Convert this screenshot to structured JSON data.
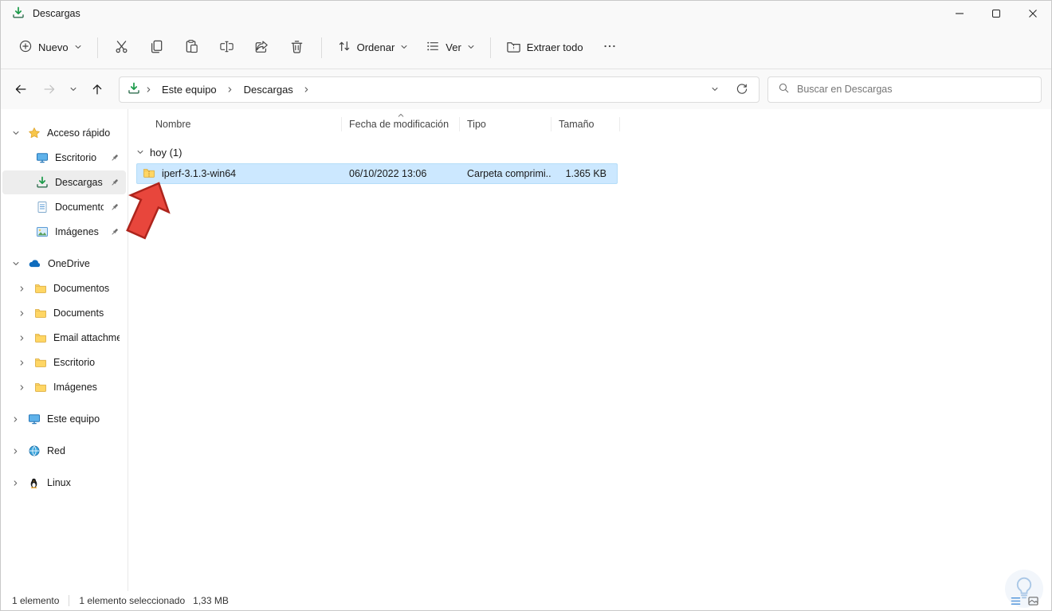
{
  "window": {
    "title": "Descargas"
  },
  "toolbar": {
    "new_label": "Nuevo",
    "sort_label": "Ordenar",
    "view_label": "Ver",
    "extract_label": "Extraer todo"
  },
  "navbar": {
    "crumb_computer": "Este equipo",
    "crumb_downloads": "Descargas",
    "search_placeholder": "Buscar en Descargas"
  },
  "columns": {
    "name": "Nombre",
    "date": "Fecha de modificación",
    "type": "Tipo",
    "size": "Tamaño"
  },
  "files": {
    "group_label": "hoy (1)",
    "rows": [
      {
        "name": "iperf-3.1.3-win64",
        "date": "06/10/2022 13:06",
        "type": "Carpeta comprimi...",
        "size": "1.365 KB"
      }
    ]
  },
  "sidebar": {
    "quick_access_label": "Acceso rápido",
    "quick_items": [
      {
        "label": "Escritorio"
      },
      {
        "label": "Descargas"
      },
      {
        "label": "Documentos"
      },
      {
        "label": "Imágenes"
      }
    ],
    "onedrive_label": "OneDrive",
    "onedrive_items": [
      {
        "label": "Documentos"
      },
      {
        "label": "Documents"
      },
      {
        "label": "Email attachments"
      },
      {
        "label": "Escritorio"
      },
      {
        "label": "Imágenes"
      }
    ],
    "computer_label": "Este equipo",
    "network_label": "Red",
    "linux_label": "Linux"
  },
  "statusbar": {
    "items_count": "1 elemento",
    "selection": "1 elemento seleccionado",
    "selection_size": "1,33 MB"
  },
  "colors": {
    "selection_blue": "#cce8ff",
    "arrow_red": "#e8463c",
    "downloads_green": "#199a48",
    "folder_yellow": "#ffd664"
  }
}
